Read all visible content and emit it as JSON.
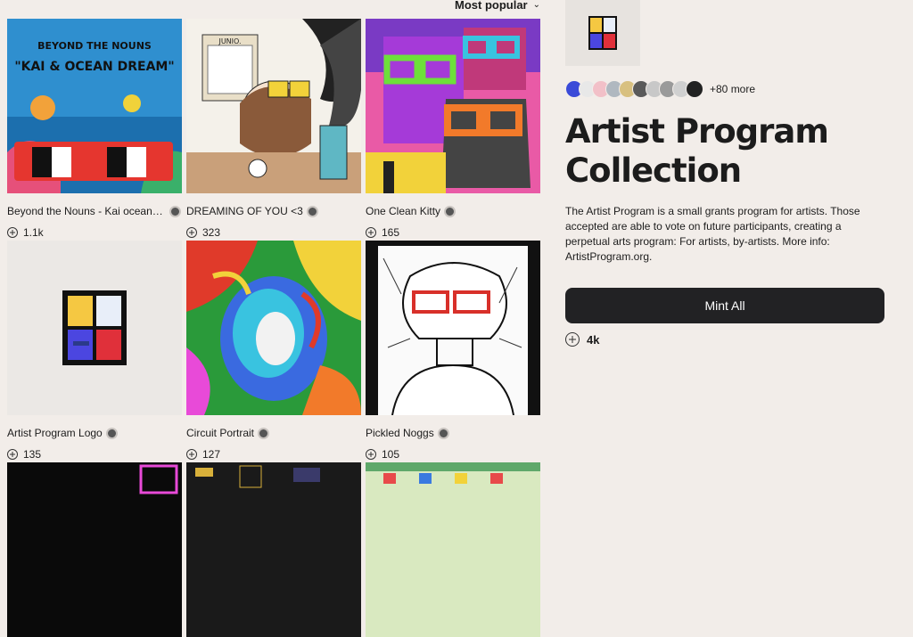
{
  "sort": {
    "label": "Most popular"
  },
  "grid": [
    {
      "title": "Beyond the Nouns - Kai ocean d...",
      "count": "1.1k",
      "art_text1": "BEYOND THE NOUNS",
      "art_text2": "\"KAI & OCEAN DREAM\""
    },
    {
      "title": "DREAMING OF YOU <3",
      "count": "323",
      "art_text1": "JUNIO."
    },
    {
      "title": "One Clean Kitty",
      "count": "165"
    },
    {
      "title": "Artist Program Logo",
      "count": "135"
    },
    {
      "title": "Circuit Portrait",
      "count": "127"
    },
    {
      "title": "Pickled Noggs",
      "count": "105"
    }
  ],
  "collection": {
    "owners_more": "+80 more",
    "title": "Artist Program Collection",
    "description": "The Artist Program is a small grants program for artists. Those accepted are able to vote on future participants, creating a perpetual arts program: For artists, by-artists. More info: ArtistProgram.org.",
    "mint_label": "Mint All",
    "mint_count": "4k"
  },
  "colors": {
    "background": "#f2ede9",
    "button": "#222224",
    "logo_yellow": "#f5c842",
    "logo_white": "#e8eef9",
    "logo_blue": "#4b46e0",
    "logo_red": "#e0303a"
  }
}
